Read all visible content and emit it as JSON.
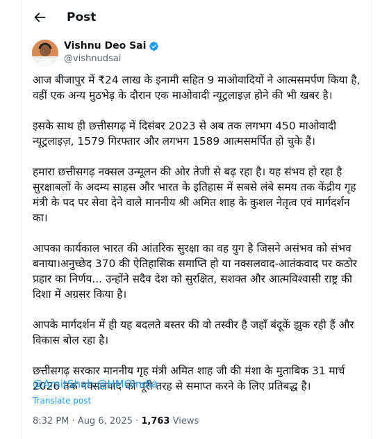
{
  "header": {
    "title": "Post"
  },
  "author": {
    "name": "Vishnu Deo Sai",
    "handle": "@vishnudsai"
  },
  "body": {
    "p1": "आज बीजापुर में ₹24 लाख के इनामी सहित 9 माओवादियों ने आत्मसमर्पण किया है, वहीं एक अन्य मुठभेड़ के दौरान एक माओवादी न्यूट्रलाइज़ होने की भी खबर है।",
    "p2": "इसके साथ ही छत्तीसगढ़ में दिसंबर 2023 से अब तक लगभग 450 माओवादी न्यूट्रलाइज़, 1579 गिरफ्तार और लगभग 1589 आत्मसमर्पित हो चुके हैं।",
    "p3": "हमारा छत्तीसगढ़ नक्सल उन्मूलन की ओर तेजी से बढ़ रहा है। यह संभव हो रहा है सुरक्षाबलों के अदम्य साहस और भारत के इतिहास में सबसे लंबे समय तक केंद्रीय गृह मंत्री के पद पर सेवा देने वाले माननीय श्री अमित शाह के कुशल नेतृत्व एवं मार्गदर्शन का।",
    "p4": "आपका कार्यकाल भारत की आंतरिक सुरक्षा का वह युग है जिसने असंभव को संभव बनाया।अनुच्छेद 370 की ऐतिहासिक समाप्ति हो या नक्सलवाद-आतंकवाद पर कठोर प्रहार का निर्णय... उन्होंने सदैव देश को सुरक्षित, सशक्त और आत्मविश्वासी राष्ट्र की दिशा में अग्रसर किया है।",
    "p5": "आपके मार्गदर्शन में ही यह बदलते बस्तर की वो तस्वीर है जहाँ बंदूकें झुक रही हैं और विकास बोल रहा है।",
    "p6": "छत्तीसगढ़ सरकार माननीय गृह मंत्री अमित शाह जी की मंशा के मुताबिक 31 मार्च 2026 तक नक्सलवाद को पूरी तरह से समाप्त करने के लिए प्रतिबद्ध है।"
  },
  "mentions": [
    "@AmitShah",
    "@HMOIndia"
  ],
  "translate_label": "Translate post",
  "meta": {
    "time": "8:32 PM",
    "separator": " · ",
    "date": "Aug 6, 2025",
    "views_count": "1,763",
    "views_label": "Views"
  },
  "colors": {
    "link": "#1d9bf0",
    "secondary": "#536471",
    "text": "#0f1419"
  }
}
